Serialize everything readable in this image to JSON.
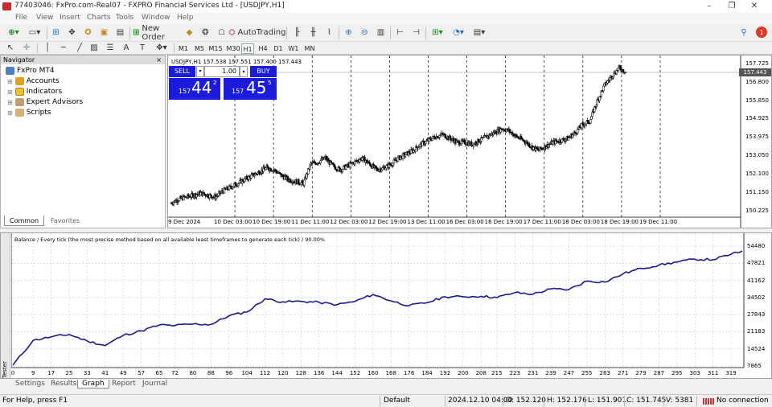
{
  "window": {
    "title": "77403046: FxPro.com-Real07 - FXPRO Financial Services Ltd - [USDJPY,H1]",
    "controls": [
      "–",
      "❐",
      "✕"
    ]
  },
  "menu": [
    "File",
    "View",
    "Insert",
    "Charts",
    "Tools",
    "Window",
    "Help"
  ],
  "toolbar": {
    "new_order_label": "New Order",
    "autotrading_label": "AutoTrading",
    "notification_count": "1"
  },
  "timeframes": [
    "M1",
    "M5",
    "M15",
    "M30",
    "H1",
    "H4",
    "D1",
    "W1",
    "MN"
  ],
  "active_timeframe": "H1",
  "navigator": {
    "title": "Navigator",
    "root": "FxPro MT4",
    "items": [
      "Accounts",
      "Indicators",
      "Expert Advisors",
      "Scripts"
    ],
    "tabs": [
      "Common",
      "Favorites"
    ]
  },
  "chart": {
    "header": "USDJPY,H1  157.538 157.551 157.400 157.443",
    "trade": {
      "sell_label": "SELL",
      "buy_label": "BUY",
      "lot": "1.00",
      "sell_prefix": "157",
      "sell_big": "44",
      "sell_sup": "2",
      "buy_prefix": "157",
      "buy_big": "45",
      "buy_sup": "5"
    },
    "current_price": "157.443",
    "price_labels": [
      "157.725",
      "156.800",
      "155.850",
      "154.925",
      "153.975",
      "153.050",
      "152.100",
      "151.150",
      "150.225"
    ],
    "time_labels": [
      "9 Dec 2024",
      "10 Dec 03:00",
      "10 Dec 19:00",
      "11 Dec 11:00",
      "12 Dec 03:00",
      "12 Dec 19:00",
      "13 Dec 11:00",
      "16 Dec 03:00",
      "16 Dec 19:00",
      "17 Dec 11:00",
      "18 Dec 03:00",
      "18 Dec 19:00",
      "19 Dec 11:00"
    ],
    "series": [
      150.6,
      150.8,
      150.9,
      151.0,
      151.1,
      151.0,
      150.9,
      151.2,
      151.4,
      151.6,
      151.8,
      152.0,
      152.2,
      152.4,
      152.3,
      152.0,
      151.8,
      151.7,
      151.6,
      152.6,
      152.7,
      152.9,
      152.5,
      152.3,
      152.5,
      152.7,
      152.9,
      152.6,
      152.3,
      152.4,
      152.6,
      152.9,
      153.1,
      153.3,
      153.6,
      153.8,
      154.0,
      154.1,
      153.9,
      153.7,
      153.7,
      153.6,
      153.8,
      154.0,
      154.2,
      154.4,
      154.3,
      154.0,
      153.8,
      153.5,
      153.3,
      153.5,
      153.7,
      153.8,
      153.9,
      154.2,
      154.6,
      154.8,
      155.8,
      156.6,
      157.1,
      157.5,
      157.3
    ],
    "colors": {
      "sell": "#1b1bdb",
      "buy": "#1b1bdb",
      "price_line": "#7a7a7a"
    }
  },
  "tester": {
    "label": "Tester",
    "caption": "Balance / Every tick (the most precise method based on all available least timeframes to generate each tick) / 90.00%",
    "y_labels": [
      "54480",
      "47821",
      "41162",
      "34502",
      "27843",
      "21183",
      "14524",
      "7865"
    ],
    "x_labels": [
      "0",
      "9",
      "17",
      "25",
      "33",
      "41",
      "49",
      "57",
      "65",
      "72",
      "80",
      "88",
      "96",
      "104",
      "112",
      "120",
      "128",
      "136",
      "144",
      "152",
      "160",
      "168",
      "176",
      "184",
      "192",
      "200",
      "208",
      "215",
      "223",
      "231",
      "239",
      "247",
      "255",
      "263",
      "271",
      "279",
      "287",
      "295",
      "303",
      "311",
      "319"
    ],
    "tabs": [
      "Settings",
      "Results",
      "Graph",
      "Report",
      "Journal"
    ],
    "active_tab": "Graph",
    "line_color": "#1a1a8c"
  },
  "chart_data": {
    "type": "line",
    "title": "Balance / Every tick (the most precise method based on all available least timeframes to generate each tick) / 90.00%",
    "xlabel": "",
    "ylabel": "",
    "ylim": [
      7865,
      54480
    ],
    "x": [
      0,
      9,
      17,
      25,
      33,
      41,
      49,
      57,
      65,
      72,
      80,
      88,
      96,
      104,
      112,
      120,
      128,
      136,
      144,
      152,
      160,
      168,
      176,
      184,
      192,
      200,
      208,
      215,
      223,
      231,
      239,
      247,
      255,
      263,
      271,
      279,
      287,
      295,
      303,
      311,
      319,
      324
    ],
    "series": [
      {
        "values": [
          8200,
          17800,
          19200,
          20100,
          17600,
          15800,
          19800,
          21500,
          23800,
          23600,
          24200,
          24000,
          27400,
          28900,
          34000,
          32800,
          33000,
          32600,
          31700,
          33000,
          35700,
          33200,
          31300,
          32500,
          34800,
          34800,
          35000,
          34500,
          36400,
          35800,
          37800,
          37600,
          40900,
          40500,
          43700,
          45800,
          47100,
          48300,
          49400,
          49200,
          51300,
          52600
        ]
      }
    ]
  },
  "status": {
    "help": "For Help, press F1",
    "profile": "Default",
    "datetime": "2024.12.10 04:00",
    "open": "O: 152.120",
    "high": "H: 152.176",
    "low": "L: 151.901",
    "close": "C: 151.745",
    "volume": "V: 5381",
    "connection": "No connection"
  }
}
